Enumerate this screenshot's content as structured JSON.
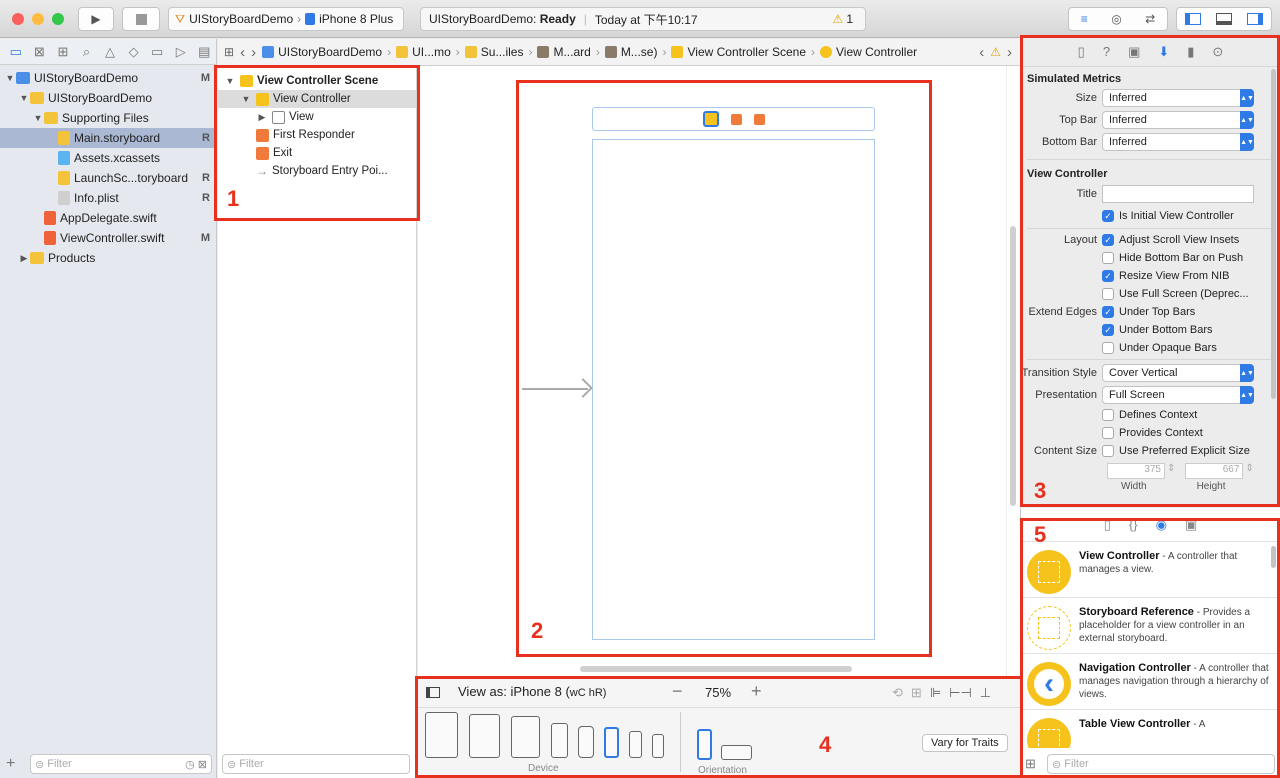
{
  "toolbar": {
    "scheme_project": "UIStoryBoardDemo",
    "scheme_device": "iPhone 8 Plus",
    "status_project": "UIStoryBoardDemo:",
    "status_state": "Ready",
    "status_time": "Today at 下午10:17",
    "warning_count": "1"
  },
  "navigator": {
    "items": [
      {
        "label": "UIStoryBoardDemo",
        "badge": "M",
        "indent": 0,
        "tri": "▼",
        "icon": "project",
        "color": "#4a8fe7"
      },
      {
        "label": "UIStoryBoardDemo",
        "badge": "",
        "indent": 1,
        "tri": "▼",
        "icon": "folder",
        "color": "#f3c33a"
      },
      {
        "label": "Supporting Files",
        "badge": "",
        "indent": 2,
        "tri": "▼",
        "icon": "folder",
        "color": "#f3c33a"
      },
      {
        "label": "Main.storyboard",
        "badge": "R",
        "indent": 3,
        "tri": "",
        "icon": "storyboard",
        "color": "#f3c33a",
        "selected": true
      },
      {
        "label": "Assets.xcassets",
        "badge": "",
        "indent": 3,
        "tri": "",
        "icon": "assets",
        "color": "#5bb3f0"
      },
      {
        "label": "LaunchSc...toryboard",
        "badge": "R",
        "indent": 3,
        "tri": "",
        "icon": "storyboard",
        "color": "#f3c33a"
      },
      {
        "label": "Info.plist",
        "badge": "R",
        "indent": 3,
        "tri": "",
        "icon": "plist",
        "color": "#cfcfcf"
      },
      {
        "label": "AppDelegate.swift",
        "badge": "",
        "indent": 2,
        "tri": "",
        "icon": "swift",
        "color": "#f0623a"
      },
      {
        "label": "ViewController.swift",
        "badge": "M",
        "indent": 2,
        "tri": "",
        "icon": "swift",
        "color": "#f0623a"
      },
      {
        "label": "Products",
        "badge": "",
        "indent": 1,
        "tri": "▶",
        "icon": "folder",
        "color": "#f3c33a"
      }
    ],
    "filter_placeholder": "Filter"
  },
  "jumpbar": {
    "items": [
      "UIStoryBoardDemo",
      "UI...mo",
      "Su...iles",
      "M...ard",
      "M...se)",
      "View Controller Scene",
      "View Controller"
    ]
  },
  "outline": {
    "scene": "View Controller Scene",
    "items": [
      {
        "label": "View Controller",
        "indent": 1,
        "tri": "▼",
        "selected": true
      },
      {
        "label": "View",
        "indent": 2,
        "tri": "▶"
      },
      {
        "label": "First Responder",
        "indent": 1,
        "tri": ""
      },
      {
        "label": "Exit",
        "indent": 1,
        "tri": ""
      },
      {
        "label": "Storyboard Entry Poi...",
        "indent": 1,
        "tri": ""
      }
    ],
    "filter_placeholder": "Filter"
  },
  "devicebar": {
    "view_as": "View as: iPhone 8 (",
    "traits": "wC hR)",
    "zoom": "75%",
    "device_label": "Device",
    "orientation_label": "Orientation",
    "vary_button": "Vary for Traits"
  },
  "inspector": {
    "sim_header": "Simulated Metrics",
    "size_label": "Size",
    "size_value": "Inferred",
    "topbar_label": "Top Bar",
    "topbar_value": "Inferred",
    "bottombar_label": "Bottom Bar",
    "bottombar_value": "Inferred",
    "vc_header": "View Controller",
    "title_label": "Title",
    "initial_vc": "Is Initial View Controller",
    "layout_label": "Layout",
    "layout_opts": [
      {
        "label": "Adjust Scroll View Insets",
        "checked": true
      },
      {
        "label": "Hide Bottom Bar on Push",
        "checked": false
      },
      {
        "label": "Resize View From NIB",
        "checked": true
      },
      {
        "label": "Use Full Screen (Deprec...",
        "checked": false
      }
    ],
    "extend_label": "Extend Edges",
    "extend_opts": [
      {
        "label": "Under Top Bars",
        "checked": true
      },
      {
        "label": "Under Bottom Bars",
        "checked": true
      },
      {
        "label": "Under Opaque Bars",
        "checked": false
      }
    ],
    "transition_label": "Transition Style",
    "transition_value": "Cover Vertical",
    "presentation_label": "Presentation",
    "presentation_value": "Full Screen",
    "defines_context": "Defines Context",
    "provides_context": "Provides Context",
    "content_size_label": "Content Size",
    "explicit_size": "Use Preferred Explicit Size",
    "width_value": "375",
    "height_value": "667",
    "width_label": "Width",
    "height_label": "Height"
  },
  "library": {
    "items": [
      {
        "title": "View Controller",
        "desc": " - A controller that manages a view.",
        "color": "#f6c21c"
      },
      {
        "title": "Storyboard Reference",
        "desc": " - Provides a placeholder for a view controller in an external storyboard.",
        "color": "#ffffff"
      },
      {
        "title": "Navigation Controller",
        "desc": " - A controller that manages navigation through a hierarchy of views.",
        "color": "#f6c21c"
      },
      {
        "title": "Table View Controller",
        "desc": " - A",
        "color": "#f6c21c"
      }
    ],
    "filter_placeholder": "Filter"
  },
  "annotations": [
    "1",
    "2",
    "3",
    "4",
    "5"
  ]
}
